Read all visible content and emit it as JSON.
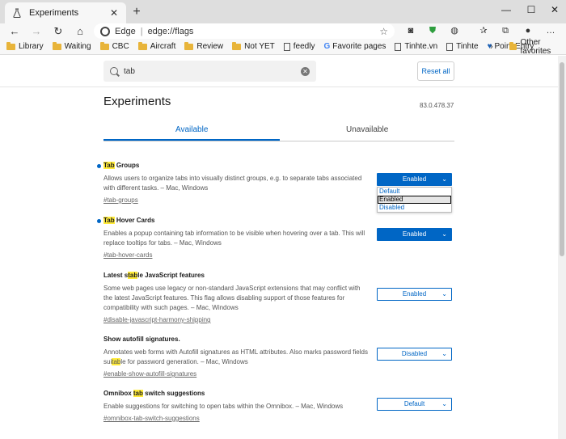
{
  "browser": {
    "tab_title": "Experiments",
    "tab_close": "✕",
    "new_tab": "+",
    "window": {
      "minimize": "—",
      "maximize": "☐",
      "close": "✕"
    },
    "omnibox": {
      "brand": "Edge",
      "separator": "|",
      "url": "edge://flags"
    }
  },
  "favorites": [
    {
      "label": "Library",
      "icon": "folder"
    },
    {
      "label": "Waiting",
      "icon": "folder"
    },
    {
      "label": "CBC",
      "icon": "folder"
    },
    {
      "label": "Aircraft",
      "icon": "folder"
    },
    {
      "label": "Review",
      "icon": "folder"
    },
    {
      "label": "Not YET",
      "icon": "folder"
    },
    {
      "label": "feedly",
      "icon": "page"
    },
    {
      "label": "Favorite pages",
      "icon": "google"
    },
    {
      "label": "Tinhte.vn",
      "icon": "page"
    },
    {
      "label": "Tinhte",
      "icon": "page"
    },
    {
      "label": "Point Entry",
      "icon": "heart"
    }
  ],
  "favorites_other": "Other favorites",
  "page": {
    "search_value": "tab",
    "reset_label": "Reset all",
    "heading": "Experiments",
    "version": "83.0.478.37",
    "tabs": {
      "available": "Available",
      "unavailable": "Unavailable"
    },
    "accent": "#0066c5",
    "highlight": "#ffeb3b"
  },
  "flags": [
    {
      "title_pre": "",
      "title_mark": "Tab",
      "title_post": " Groups",
      "description": "Allows users to organize tabs into visually distinct groups, e.g. to separate tabs associated with different tasks. – Mac, Windows",
      "desc_pre": "",
      "desc_mark": "",
      "desc_post": "",
      "link": "#tab-groups",
      "value": "Enabled",
      "modified": true,
      "dropdown_open": true,
      "options": [
        "Default",
        "Enabled",
        "Disabled"
      ]
    },
    {
      "title_pre": "",
      "title_mark": "Tab",
      "title_post": " Hover Cards",
      "description": "Enables a popup containing tab information to be visible when hovering over a tab. This will replace tooltips for tabs. – Mac, Windows",
      "link": "#tab-hover-cards",
      "value": "Enabled",
      "modified": true
    },
    {
      "title_pre": "Latest s",
      "title_mark": "tab",
      "title_post": "le JavaScript features",
      "description": "Some web pages use legacy or non-standard JavaScript extensions that may conflict with the latest JavaScript features. This flag allows disabling support of those features for compatibility with such pages. – Mac, Windows",
      "link": "#disable-javascript-harmony-shipping",
      "value": "Enabled",
      "modified": false
    },
    {
      "title_pre": "Show autofill signatures.",
      "title_mark": "",
      "title_post": "",
      "desc_pre": "Annotates web forms with Autofill signatures as HTML attributes. Also marks password fields sui",
      "desc_mark": "tab",
      "desc_post": "le for password generation. – Mac, Windows",
      "link": "#enable-show-autofill-signatures",
      "value": "Disabled",
      "modified": false
    },
    {
      "title_pre": "Omnibox ",
      "title_mark": "tab",
      "title_post": " switch suggestions",
      "description": "Enable suggestions for switching to open tabs within the Omnibox. – Mac, Windows",
      "link": "#omnibox-tab-switch-suggestions",
      "value": "Default",
      "modified": false
    }
  ]
}
